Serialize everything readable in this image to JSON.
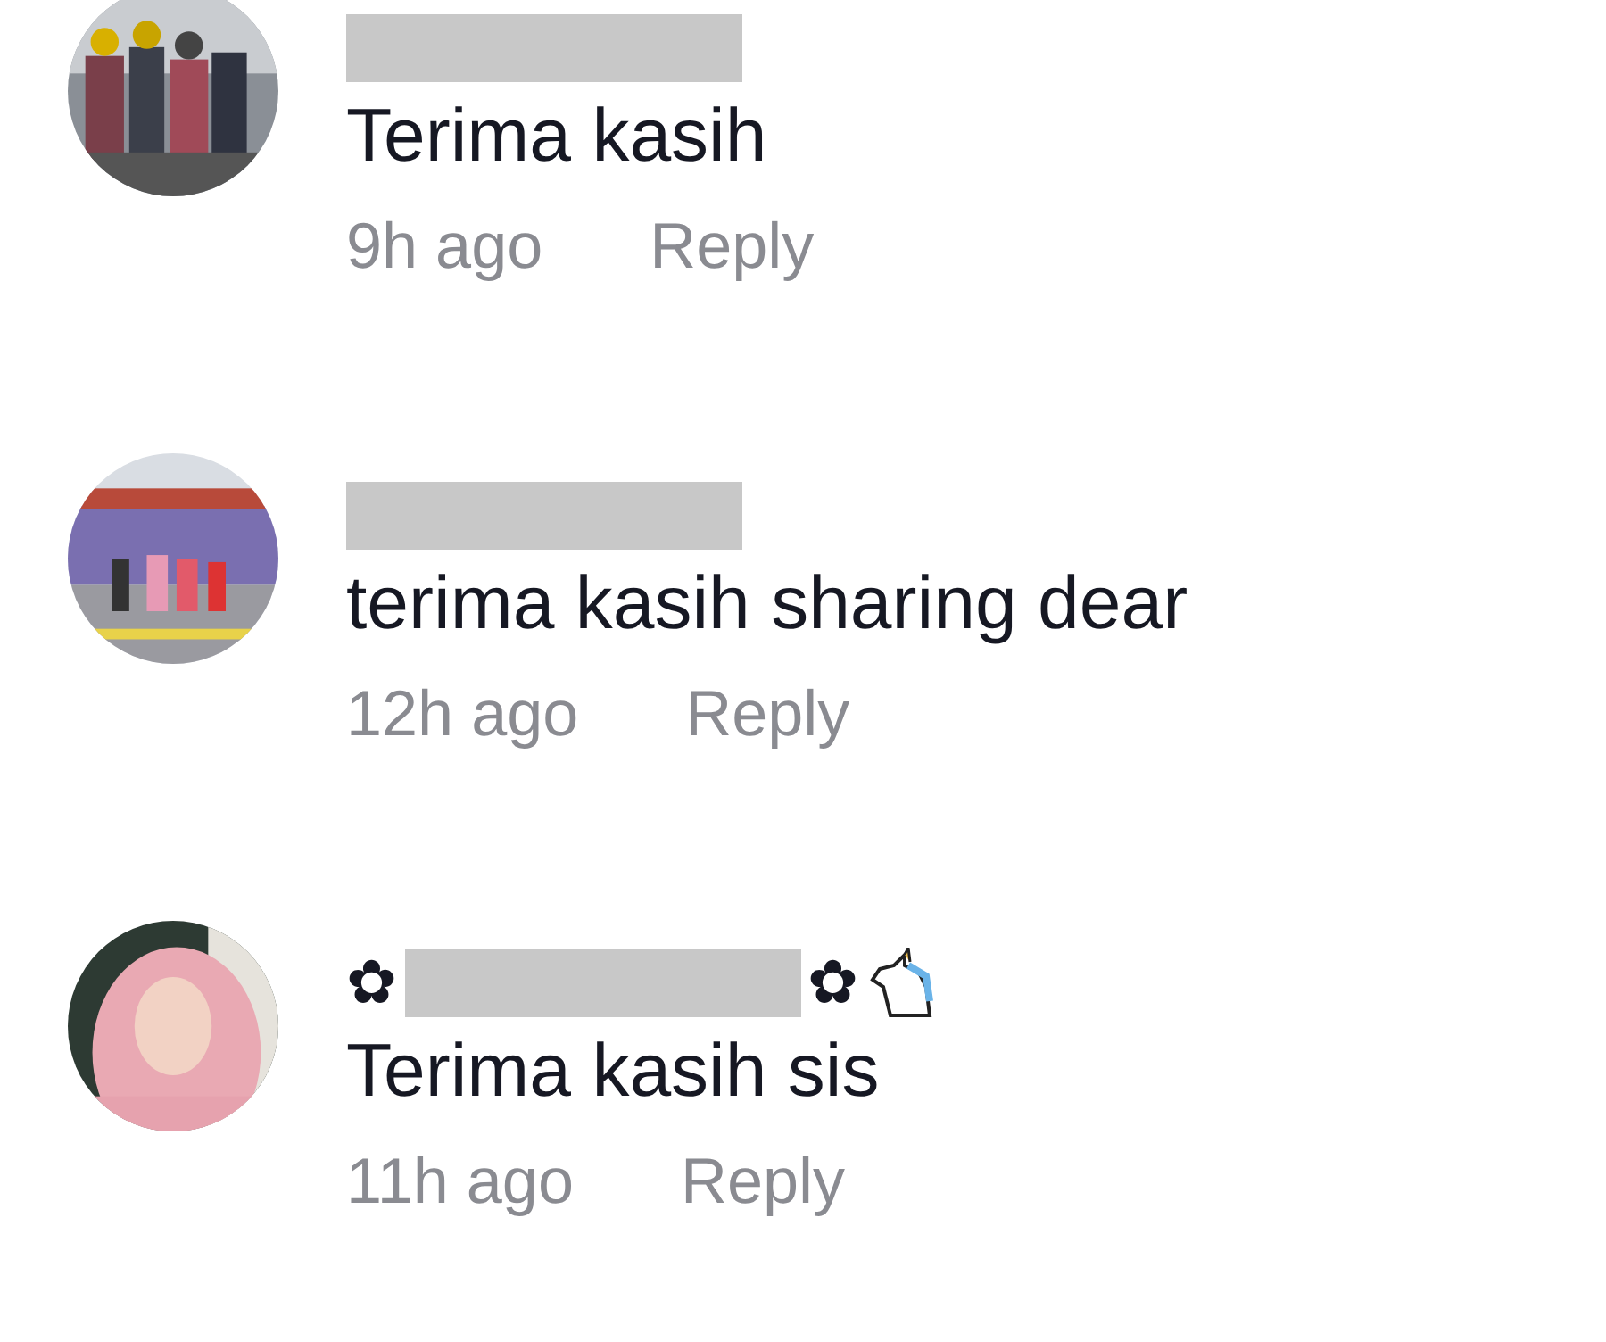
{
  "comments": [
    {
      "name": [
        {
          "kind": "redacted"
        }
      ],
      "text": "Terima kasih",
      "time": "9h ago",
      "reply": "Reply"
    },
    {
      "name": [
        {
          "kind": "redacted"
        }
      ],
      "text": "terima kasih sharing dear",
      "time": "12h ago",
      "reply": "Reply"
    },
    {
      "name": [
        {
          "kind": "text",
          "text": "✿"
        },
        {
          "kind": "redacted"
        },
        {
          "kind": "text",
          "text": "✿"
        },
        {
          "kind": "unicorn"
        }
      ],
      "text": "Terima kasih sis",
      "time": "11h ago",
      "reply": "Reply"
    }
  ]
}
